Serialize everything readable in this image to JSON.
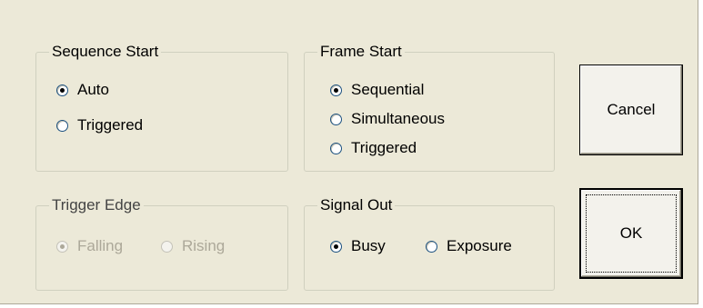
{
  "groups": {
    "sequence_start": {
      "title": "Sequence Start",
      "options": [
        "Auto",
        "Triggered"
      ],
      "selected": "Auto"
    },
    "frame_start": {
      "title": "Frame Start",
      "options": [
        "Sequential",
        "Simultaneous",
        "Triggered"
      ],
      "selected": "Sequential"
    },
    "trigger_edge": {
      "title": "Trigger Edge",
      "options": [
        "Falling",
        "Rising"
      ],
      "selected": "Falling",
      "disabled": true
    },
    "signal_out": {
      "title": "Signal Out",
      "options": [
        "Busy",
        "Exposure"
      ],
      "selected": "Busy"
    }
  },
  "buttons": {
    "cancel": "Cancel",
    "ok": "OK"
  },
  "colors": {
    "face": "#ece9d8",
    "disabled_text": "#aca899",
    "group_border": "#d0d0bf"
  }
}
